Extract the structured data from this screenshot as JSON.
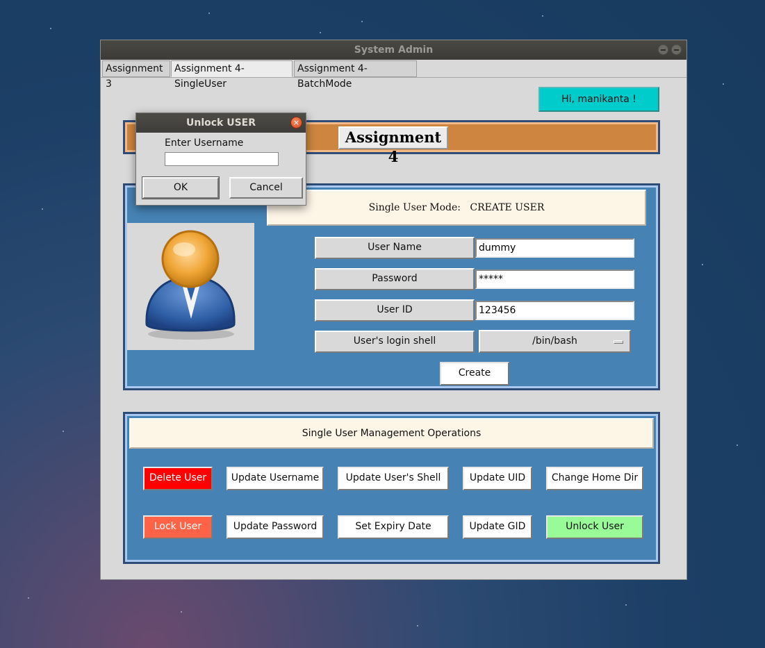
{
  "window": {
    "title": "System Admin",
    "tabs": [
      "Assignment 3",
      "Assignment 4-SingleUser",
      "Assignment 4-BatchMode"
    ],
    "active_tab": "Assignment 4-SingleUser"
  },
  "header": {
    "greeting": "Hi, manikanta !",
    "banner_title": "Assignment 4"
  },
  "create_panel": {
    "mode_prefix": "Single User Mode:",
    "mode_value": "CREATE USER",
    "fields": {
      "username_label": "User Name",
      "username_value": "dummy",
      "password_label": "Password",
      "password_value": "*****",
      "userid_label": "User ID",
      "userid_value": "123456",
      "shell_label": "User's login shell",
      "shell_value": "/bin/bash"
    },
    "create_label": "Create"
  },
  "mgmt_panel": {
    "title": "Single User Management Operations",
    "buttons": {
      "delete_user": "Delete User",
      "update_username": "Update Username",
      "update_shell": "Update User's Shell",
      "update_uid": "Update UID",
      "change_home": "Change Home Dir",
      "lock_user": "Lock User",
      "update_password": "Update Password",
      "set_expiry": "Set Expiry Date",
      "update_gid": "Update GID",
      "unlock_user": "Unlock User"
    }
  },
  "dialog": {
    "title": "Unlock USER",
    "prompt": "Enter Username",
    "input_value": "",
    "ok_label": "OK",
    "cancel_label": "Cancel"
  },
  "colors": {
    "panel_bg": "#4682b4",
    "banner_bg": "#cd853f",
    "greeting_bg": "#00cccc",
    "delete_bg": "#ff0000",
    "lock_bg": "#ff6347",
    "unlock_bg": "#98fb98"
  }
}
